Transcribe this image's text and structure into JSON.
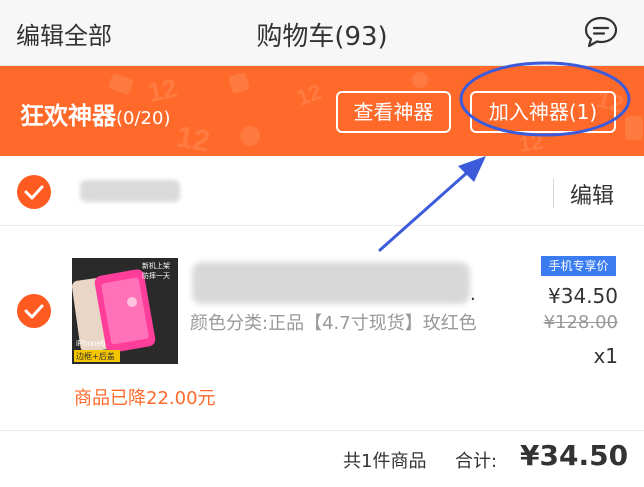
{
  "nav": {
    "left_label": "编辑全部",
    "title": "购物车(93)",
    "chat_icon": "chat-bubble-icon"
  },
  "banner": {
    "title": "狂欢神器",
    "count": "(0/20)",
    "view_button": "查看神器",
    "add_button": "加入神器(1)",
    "background_color": "#ff6a2b"
  },
  "shop": {
    "edit_label": "编辑",
    "selected": true
  },
  "item": {
    "selected": true,
    "title_suffix": ".",
    "spec": "颜色分类:正品【4.7寸现货】玫红色",
    "badge": "手机专享价",
    "price": "¥34.50",
    "original_price": "¥128.00",
    "quantity": "x1",
    "reduced_note": "商品已降22.00元",
    "thumb_caption": "iPhone6",
    "thumb_tags": [
      "新机上架",
      "防摔一天",
      "边框+后盖"
    ]
  },
  "footer": {
    "count_label": "共1件商品",
    "total_label": "合计:",
    "total_value": "¥34.50"
  },
  "colors": {
    "accent": "#ff6a2b",
    "check": "#ff5a1f",
    "annotation": "#3b5bdb",
    "badge": "#3b7df0"
  }
}
